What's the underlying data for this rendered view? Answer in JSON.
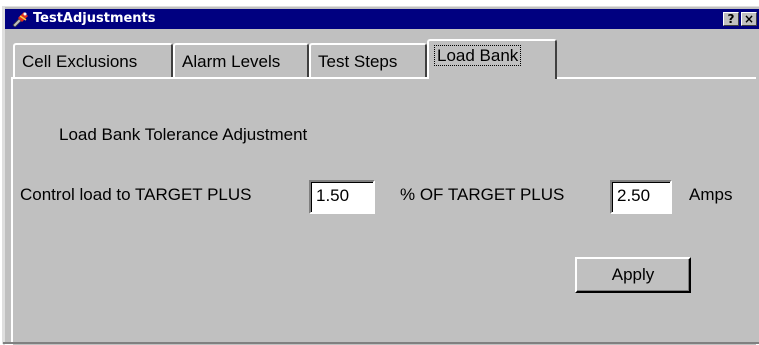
{
  "window": {
    "title": "TestAdjustments",
    "help_label": "?",
    "close_label": "×"
  },
  "tabs": [
    {
      "label": "Cell Exclusions",
      "active": false
    },
    {
      "label": "Alarm Levels",
      "active": false
    },
    {
      "label": "Test Steps",
      "active": false
    },
    {
      "label": "Load Bank",
      "active": true
    }
  ],
  "panel": {
    "heading": "Load Bank Tolerance Adjustment",
    "control_label": "Control load  to TARGET PLUS",
    "percent_value": "1.50",
    "percent_label": "% OF TARGET  PLUS",
    "amps_value": "2.50",
    "amps_label": "Amps",
    "apply_label": "Apply"
  },
  "colors": {
    "titlebar": "#000080",
    "face": "#c0c0c0"
  }
}
